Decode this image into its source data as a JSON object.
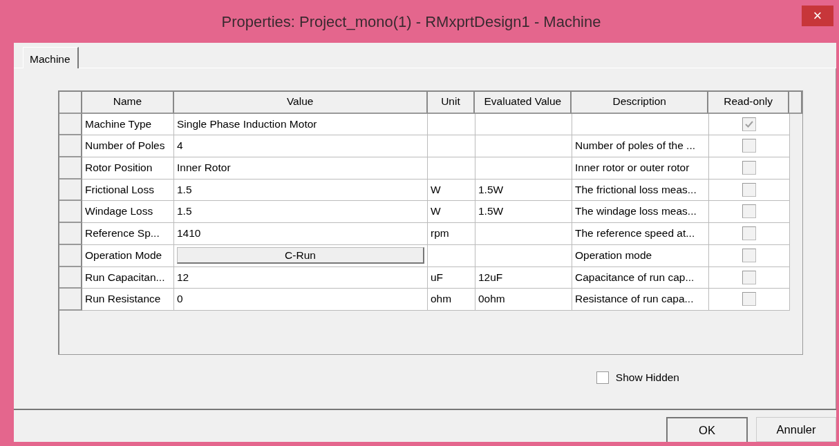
{
  "window": {
    "title": "Properties: Project_mono(1) - RMxprtDesign1 - Machine",
    "close": "×"
  },
  "tabs": [
    {
      "label": "Machine",
      "selected": true
    }
  ],
  "table": {
    "columns": [
      "Name",
      "Value",
      "Unit",
      "Evaluated Value",
      "Description",
      "Read-only"
    ],
    "rows": [
      {
        "kind": "text",
        "name": "Machine Type",
        "value": "Single Phase Induction Motor",
        "read_only": true
      },
      {
        "kind": "text",
        "name": "Number of Poles",
        "value": "4",
        "description": "Number of poles of the ...",
        "read_only": false
      },
      {
        "kind": "text",
        "name": "Rotor Position",
        "value": "Inner Rotor",
        "description": "Inner rotor or outer rotor",
        "read_only": false
      },
      {
        "kind": "text",
        "name": "Frictional Loss",
        "value": "1.5",
        "unit": "W",
        "evaluated": "1.5W",
        "description": "The frictional loss meas...",
        "read_only": false
      },
      {
        "kind": "text",
        "name": "Windage Loss",
        "value": "1.5",
        "unit": "W",
        "evaluated": "1.5W",
        "description": "The windage loss meas...",
        "read_only": false
      },
      {
        "kind": "text",
        "name": "Reference Sp...",
        "value": "1410",
        "unit": "rpm",
        "description": "The reference speed at...",
        "read_only": false
      },
      {
        "kind": "button",
        "name": "Operation Mode",
        "value": "C-Run",
        "description": "Operation mode",
        "read_only": false
      },
      {
        "kind": "text",
        "name": "Run Capacitan...",
        "value": "12",
        "unit": "uF",
        "evaluated": "12uF",
        "description": "Capacitance of run cap...",
        "read_only": false
      },
      {
        "kind": "text",
        "name": "Run Resistance",
        "value": "0",
        "unit": "ohm",
        "evaluated": "0ohm",
        "description": "Resistance of run capa...",
        "read_only": false
      }
    ]
  },
  "show_hidden": {
    "label": "Show Hidden",
    "checked": false
  },
  "buttons": [
    {
      "label": "OK",
      "default": true
    },
    {
      "label": "Annuler",
      "default": false
    }
  ]
}
